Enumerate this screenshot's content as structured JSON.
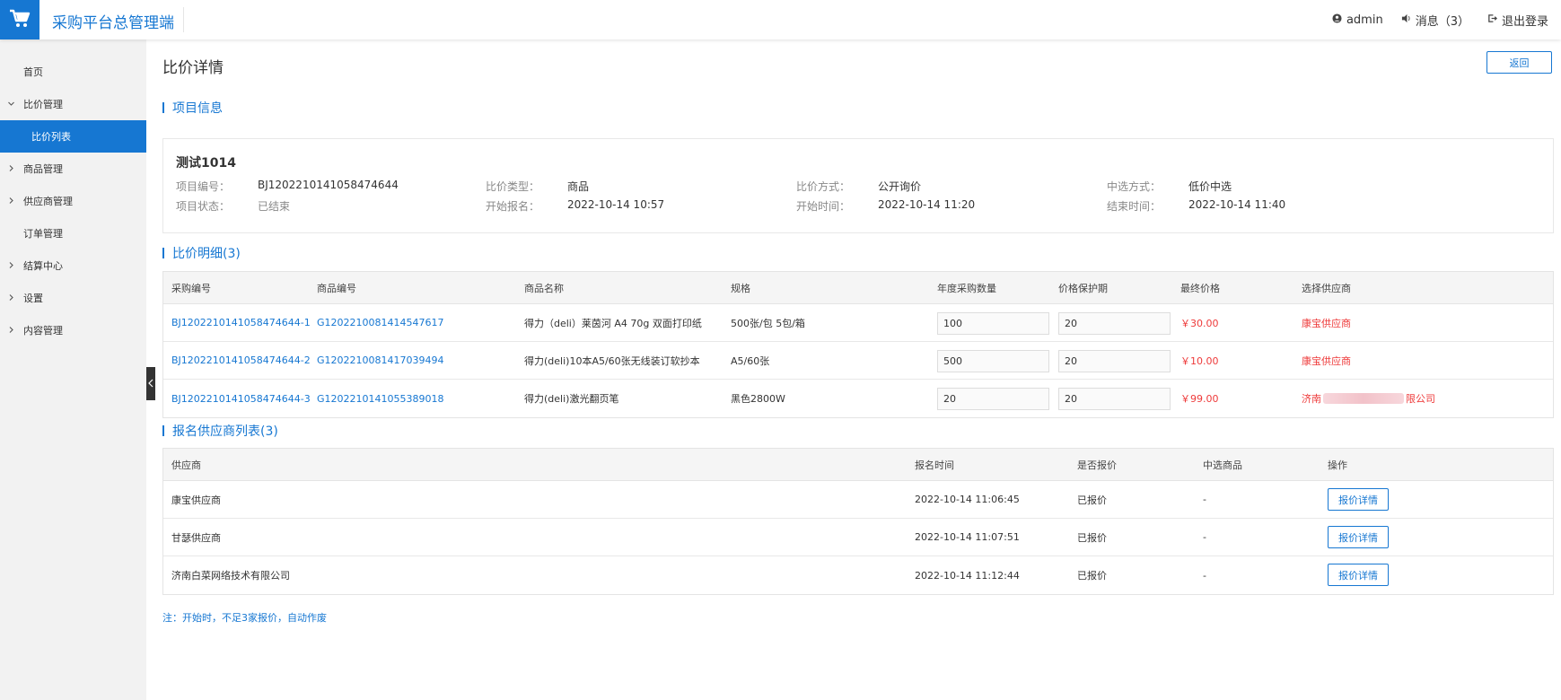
{
  "app": {
    "title": "采购平台总管理端"
  },
  "header": {
    "user": "admin",
    "messages_label": "消息（3）",
    "logout_label": "退出登录"
  },
  "sidebar": {
    "items": [
      {
        "label": "首页"
      },
      {
        "label": "比价管理"
      },
      {
        "label": "比价列表"
      },
      {
        "label": "商品管理"
      },
      {
        "label": "供应商管理"
      },
      {
        "label": "订单管理"
      },
      {
        "label": "结算中心"
      },
      {
        "label": "设置"
      },
      {
        "label": "内容管理"
      }
    ]
  },
  "page": {
    "title": "比价详情",
    "back_label": "返回"
  },
  "project_section": {
    "title": "项目信息",
    "name": "测试1014",
    "fields": [
      {
        "label": "项目编号：",
        "value": "BJ1202210141058474644"
      },
      {
        "label": "比价类型：",
        "value": "商品"
      },
      {
        "label": "比价方式：",
        "value": "公开询价"
      },
      {
        "label": "中选方式：",
        "value": "低价中选"
      },
      {
        "label": "项目状态：",
        "value": "已结束"
      },
      {
        "label": "开始报名：",
        "value": "2022-10-14 10:57"
      },
      {
        "label": "开始时间：",
        "value": "2022-10-14 11:20"
      },
      {
        "label": "结束时间：",
        "value": "2022-10-14 11:40"
      }
    ]
  },
  "detail_section": {
    "title": "比价明细(3)",
    "columns": [
      "采购编号",
      "商品编号",
      "商品名称",
      "规格",
      "年度采购数量",
      "价格保护期",
      "最终价格",
      "选择供应商"
    ],
    "rows": [
      {
        "purchase_no": "BJ1202210141058474644-1",
        "goods_no": "G1202210081414547617",
        "name": "得力（deli）莱茵河 A4 70g 双面打印纸",
        "spec": "500张/包 5包/箱",
        "qty": "100",
        "protect": "20",
        "price": "￥30.00",
        "supplier": "康宝供应商"
      },
      {
        "purchase_no": "BJ1202210141058474644-2",
        "goods_no": "G1202210081417039494",
        "name": "得力(deli)10本A5/60张无线装订软抄本",
        "spec": "A5/60张",
        "qty": "500",
        "protect": "20",
        "price": "￥10.00",
        "supplier": "康宝供应商"
      },
      {
        "purchase_no": "BJ1202210141058474644-3",
        "goods_no": "G1202210141055389018",
        "name": "得力(deli)激光翻页笔",
        "spec": "黑色2800W",
        "qty": "20",
        "protect": "20",
        "price": "￥99.00",
        "supplier_prefix": "济南",
        "supplier_suffix": "限公司"
      }
    ]
  },
  "supplier_section": {
    "title": "报名供应商列表(3)",
    "columns": [
      "供应商",
      "报名时间",
      "是否报价",
      "中选商品",
      "操作"
    ],
    "rows": [
      {
        "name": "康宝供应商",
        "time": "2022-10-14 11:06:45",
        "quoted": "已报价",
        "selected": "-",
        "action": "报价详情"
      },
      {
        "name": "甘瑟供应商",
        "time": "2022-10-14 11:07:51",
        "quoted": "已报价",
        "selected": "-",
        "action": "报价详情"
      },
      {
        "name": "济南白菜网络技术有限公司",
        "time": "2022-10-14 11:12:44",
        "quoted": "已报价",
        "selected": "-",
        "action": "报价详情"
      }
    ]
  },
  "note": "注：开始时，不足3家报价，自动作废",
  "colors": {
    "accent": "#1677d2",
    "price_red": "#ee3a3a",
    "sidebar_bg": "#f2f2f2"
  },
  "icons": [
    "cart-icon",
    "user-icon",
    "speaker-icon",
    "logout-icon",
    "chevron-down-icon",
    "chevron-right-icon",
    "chevron-left-icon"
  ]
}
